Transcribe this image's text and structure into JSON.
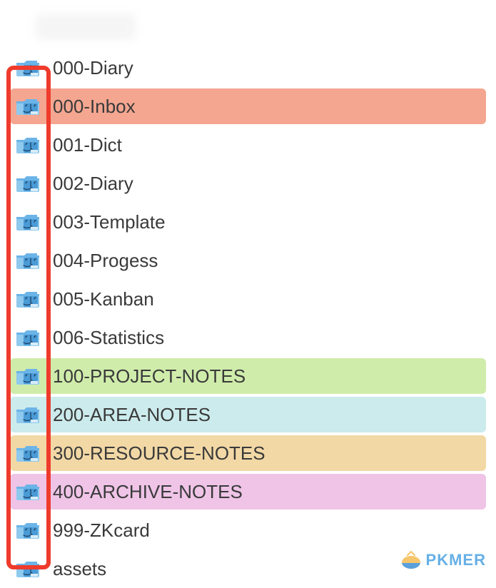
{
  "folders": [
    {
      "label": "000-Diary",
      "bg": ""
    },
    {
      "label": "000-Inbox",
      "bg": "bg-salmon"
    },
    {
      "label": "001-Dict",
      "bg": ""
    },
    {
      "label": "002-Diary",
      "bg": ""
    },
    {
      "label": "003-Template",
      "bg": ""
    },
    {
      "label": "004-Progess",
      "bg": ""
    },
    {
      "label": "005-Kanban",
      "bg": ""
    },
    {
      "label": "006-Statistics",
      "bg": ""
    },
    {
      "label": "100-PROJECT-NOTES",
      "bg": "bg-green"
    },
    {
      "label": "200-AREA-NOTES",
      "bg": "bg-cyan"
    },
    {
      "label": "300-RESOURCE-NOTES",
      "bg": "bg-tan"
    },
    {
      "label": "400-ARCHIVE-NOTES",
      "bg": "bg-pink"
    },
    {
      "label": "999-ZKcard",
      "bg": ""
    },
    {
      "label": "assets",
      "bg": ""
    }
  ],
  "watermark": {
    "text": "PKMER"
  },
  "icons": {
    "folder_name": "finder-folder-icon"
  }
}
